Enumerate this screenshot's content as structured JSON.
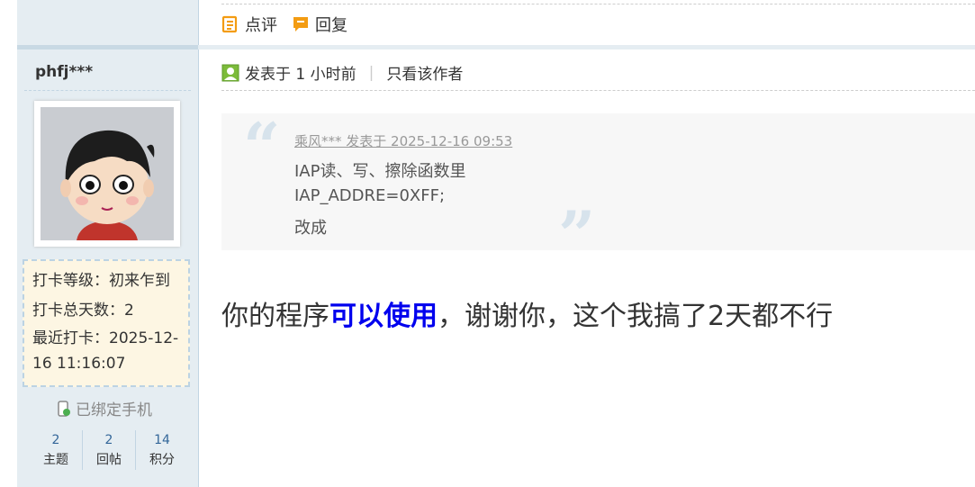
{
  "profile": {
    "username": "phfj***",
    "checkin_level": "打卡等级：初来乍到",
    "checkin_total": "打卡总天数：2",
    "last_checkin": "最近打卡：2025-12-16 11:16:07",
    "phone_bound": "已绑定手机",
    "stats": [
      {
        "value": "2",
        "label": "主题"
      },
      {
        "value": "2",
        "label": "回帖"
      },
      {
        "value": "14",
        "label": "积分"
      }
    ]
  },
  "actions": {
    "review": "点评",
    "reply": "回复"
  },
  "post": {
    "posted": "发表于 1 小时前",
    "author_only": "只看该作者"
  },
  "quote": {
    "source": "乘风*** 发表于 2025-12-16 09:53",
    "lines": [
      "IAP读、写、擦除函数里",
      "IAP_ADDRE=0XFF;",
      "改成"
    ]
  },
  "reply": {
    "before": "你的程序",
    "highlight": "可以使用",
    "after": "，谢谢你，这个我搞了2天都不行"
  },
  "colors": {
    "sidebar_bg": "#e5edf2",
    "accent_orange": "#f39c12",
    "highlight_blue": "#0000ee"
  }
}
